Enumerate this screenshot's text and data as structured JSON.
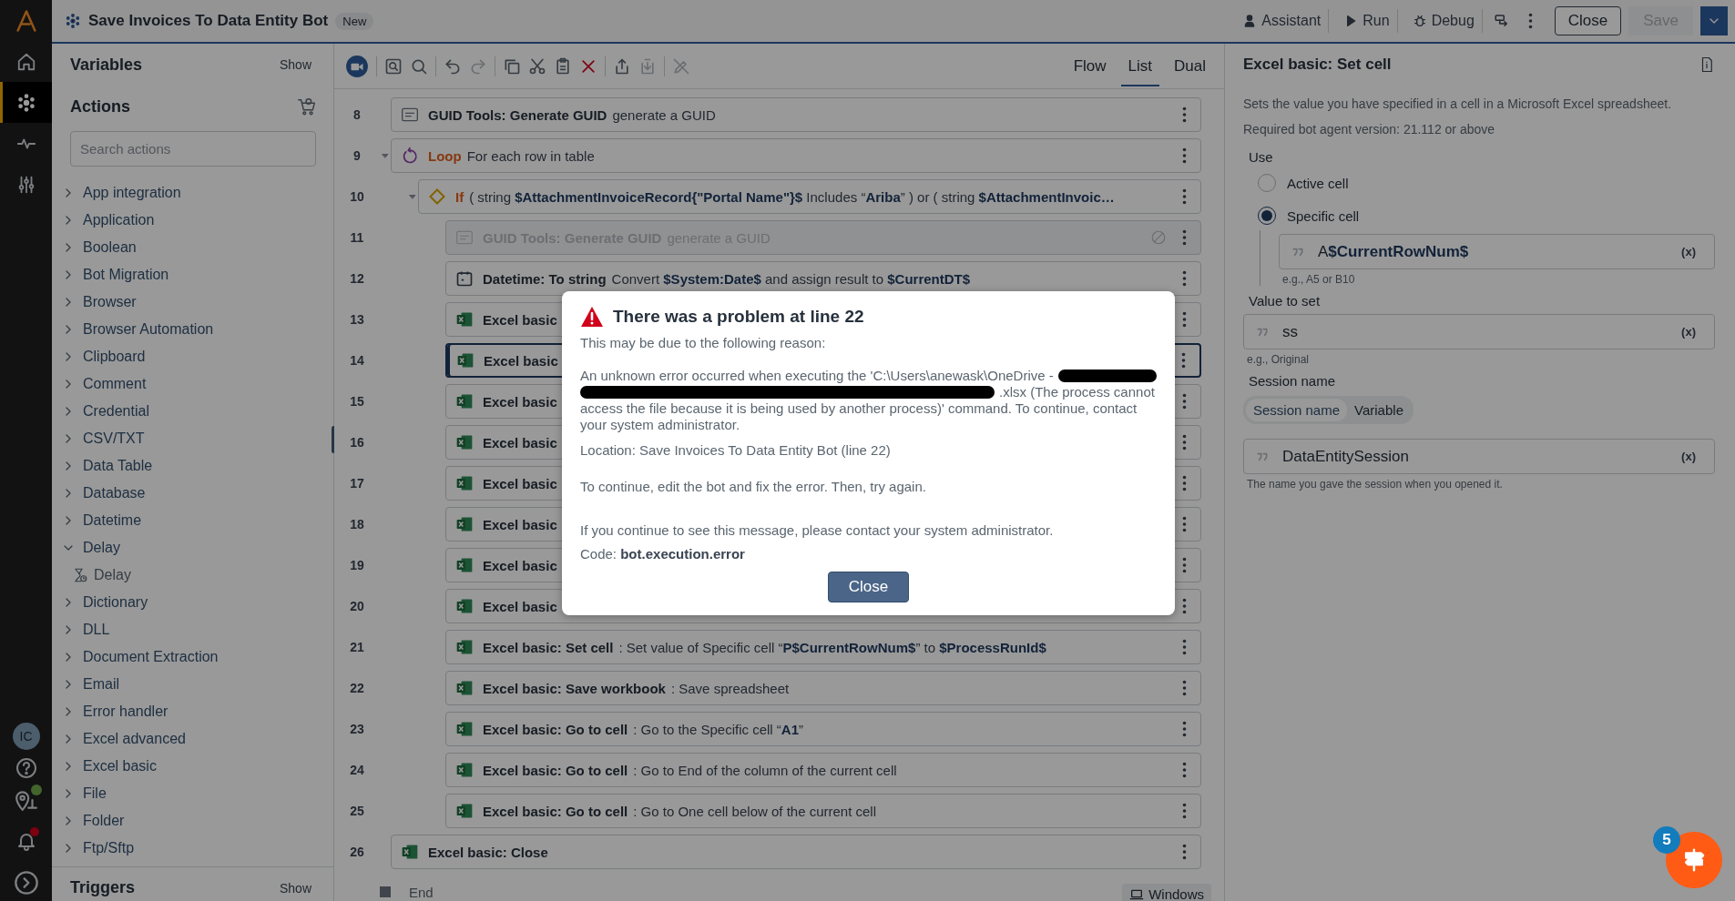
{
  "app": {
    "title": "Save Invoices To Data Entity Bot",
    "badge": "New",
    "actions": [
      {
        "kind": "assistant",
        "label": "Assistant"
      },
      {
        "kind": "run",
        "label": "Run"
      },
      {
        "kind": "debug",
        "label": "Debug"
      }
    ],
    "close": "Close",
    "save": {
      "label": "Save",
      "disabled": true
    }
  },
  "rail": {
    "items": [
      {
        "kind": "home",
        "selected": false
      },
      {
        "kind": "bots",
        "selected": true
      },
      {
        "kind": "activity",
        "selected": false
      },
      {
        "kind": "settings",
        "selected": false
      }
    ],
    "avatar": "IC",
    "notification": true
  },
  "left": {
    "variables": {
      "title": "Variables",
      "toggle": "Show"
    },
    "actions": {
      "title": "Actions",
      "search_placeholder": "Search actions",
      "items": [
        {
          "label": "App integration",
          "expanded": false
        },
        {
          "label": "Application",
          "expanded": false
        },
        {
          "label": "Boolean",
          "expanded": false
        },
        {
          "label": "Bot Migration",
          "expanded": false
        },
        {
          "label": "Browser",
          "expanded": false
        },
        {
          "label": "Browser Automation",
          "expanded": false
        },
        {
          "label": "Clipboard",
          "expanded": false
        },
        {
          "label": "Comment",
          "expanded": false
        },
        {
          "label": "Credential",
          "expanded": false
        },
        {
          "label": "CSV/TXT",
          "expanded": false
        },
        {
          "label": "Data Table",
          "expanded": false
        },
        {
          "label": "Database",
          "expanded": false
        },
        {
          "label": "Datetime",
          "expanded": false
        },
        {
          "label": "Delay",
          "expanded": true,
          "children": [
            {
              "label": "Delay"
            }
          ]
        },
        {
          "label": "Dictionary",
          "expanded": false
        },
        {
          "label": "DLL",
          "expanded": false
        },
        {
          "label": "Document Extraction",
          "expanded": false
        },
        {
          "label": "Email",
          "expanded": false
        },
        {
          "label": "Error handler",
          "expanded": false
        },
        {
          "label": "Excel advanced",
          "expanded": false
        },
        {
          "label": "Excel basic",
          "expanded": false
        },
        {
          "label": "File",
          "expanded": false
        },
        {
          "label": "Folder",
          "expanded": false
        },
        {
          "label": "Ftp/Sftp",
          "expanded": false
        }
      ]
    },
    "triggers": {
      "title": "Triggers",
      "toggle": "Show"
    }
  },
  "editor": {
    "views": [
      {
        "label": "Flow",
        "selected": false
      },
      {
        "label": "List",
        "selected": true
      },
      {
        "label": "Dual",
        "selected": false
      }
    ],
    "steps": [
      {
        "line": "8",
        "kind": "package",
        "title": "GUID Tools: Generate GUID",
        "detail": "generate a GUID",
        "selected": false,
        "disabled": false
      },
      {
        "line": "9",
        "kind": "loop",
        "title": "Loop",
        "detail": "For each row in table",
        "selected": false,
        "disabled": false,
        "expanded": true,
        "children": [
          {
            "line": "10",
            "kind": "if",
            "title": "If",
            "detail": "( string **$AttachmentInvoiceRecord{\"Portal Name\"}$** Includes “**Ariba**” ) or ( string **$AttachmentInvoic…**",
            "selected": false,
            "disabled": false,
            "expanded": true,
            "children": [
              {
                "line": "11",
                "kind": "package",
                "title": "GUID Tools: Generate GUID",
                "detail": "generate a GUID",
                "selected": false,
                "disabled": true
              },
              {
                "line": "12",
                "kind": "datetime",
                "title": "Datetime: To string",
                "detail": "Convert **$System:Date$** and assign result to **$CurrentDT$**",
                "selected": false,
                "disabled": false
              },
              {
                "line": "13",
                "kind": "excel",
                "title": "Excel basic",
                "selected": false,
                "disabled": false
              },
              {
                "line": "14",
                "kind": "excel",
                "title": "Excel basic",
                "selected": true,
                "disabled": false
              },
              {
                "line": "15",
                "kind": "excel",
                "title": "Excel basic",
                "selected": false,
                "disabled": false
              },
              {
                "line": "16",
                "kind": "excel",
                "title": "Excel basic",
                "selected": false,
                "disabled": false
              },
              {
                "line": "17",
                "kind": "excel",
                "title": "Excel basic",
                "selected": false,
                "disabled": false
              },
              {
                "line": "18",
                "kind": "excel",
                "title": "Excel basic",
                "selected": false,
                "disabled": false
              },
              {
                "line": "19",
                "kind": "excel",
                "title": "Excel basic",
                "selected": false,
                "disabled": false
              },
              {
                "line": "20",
                "kind": "excel",
                "title": "Excel basic",
                "selected": false,
                "disabled": false
              },
              {
                "line": "21",
                "kind": "excel",
                "title": "Excel basic: Set cell",
                "detail": ": Set value of Specific cell “**P$CurrentRowNum$**” to **$ProcessRunId$**",
                "selected": false,
                "disabled": false
              },
              {
                "line": "22",
                "kind": "excel",
                "title": "Excel basic: Save workbook",
                "detail": ": Save spreadsheet",
                "selected": false,
                "disabled": false
              },
              {
                "line": "23",
                "kind": "excel",
                "title": "Excel basic: Go to cell",
                "detail": ": Go to the Specific cell “**A1**”",
                "selected": false,
                "disabled": false
              },
              {
                "line": "24",
                "kind": "excel",
                "title": "Excel basic: Go to cell",
                "detail": ": Go to End of the column of the current cell",
                "selected": false,
                "disabled": false
              },
              {
                "line": "25",
                "kind": "excel",
                "title": "Excel basic: Go to cell",
                "detail": ": Go to One cell below of the current cell",
                "selected": false,
                "disabled": false
              }
            ]
          }
        ]
      },
      {
        "line": "26",
        "kind": "excel",
        "title": "Excel basic: Close",
        "selected": false,
        "disabled": false
      }
    ],
    "end": "End",
    "platform": "Windows"
  },
  "dialog": {
    "title": "There was a problem at line 22",
    "intro": "This may be due to the following reason:",
    "error_start": "An unknown error occurred when executing the 'C:\\Users\\anewask\\OneDrive -",
    "error_middle": ".xlsx (The process cannot",
    "error_end": "access the file because it is being used by another process)' command. To continue, contact your system administrator.",
    "location": "Location: Save Invoices To Data Entity Bot (line 22)",
    "advice": "To continue, edit the bot and fix the error. Then, try again.",
    "contact": "If you continue to see this message, please contact your system administrator.",
    "code": "Code: **bot.execution.error**",
    "button": "Close"
  },
  "properties": {
    "title": "Excel basic: Set cell",
    "description": "Sets the value you have specified in a cell in a Microsoft Excel spreadsheet.",
    "requirement": "Required bot agent version: 21.112 or above",
    "use": {
      "label": "Use",
      "options": [
        {
          "label": "Active cell",
          "selected": false
        },
        {
          "label": "Specific cell",
          "selected": true
        }
      ],
      "value": "A**$CurrentRowNum$**",
      "variable_button": "(x)",
      "hint": "e.g., A5 or B10"
    },
    "value_to_set": {
      "label": "Value to set",
      "value": "ss",
      "variable_button": "(x)",
      "hint": "e.g., Original"
    },
    "session": {
      "label": "Session name",
      "modes": [
        {
          "label": "Session name",
          "selected": true
        },
        {
          "label": "Variable",
          "selected": false
        }
      ],
      "value": "DataEntitySession",
      "variable_button": "(x)",
      "hint": "The name you gave the session when you opened it."
    }
  },
  "help_badge": "5"
}
